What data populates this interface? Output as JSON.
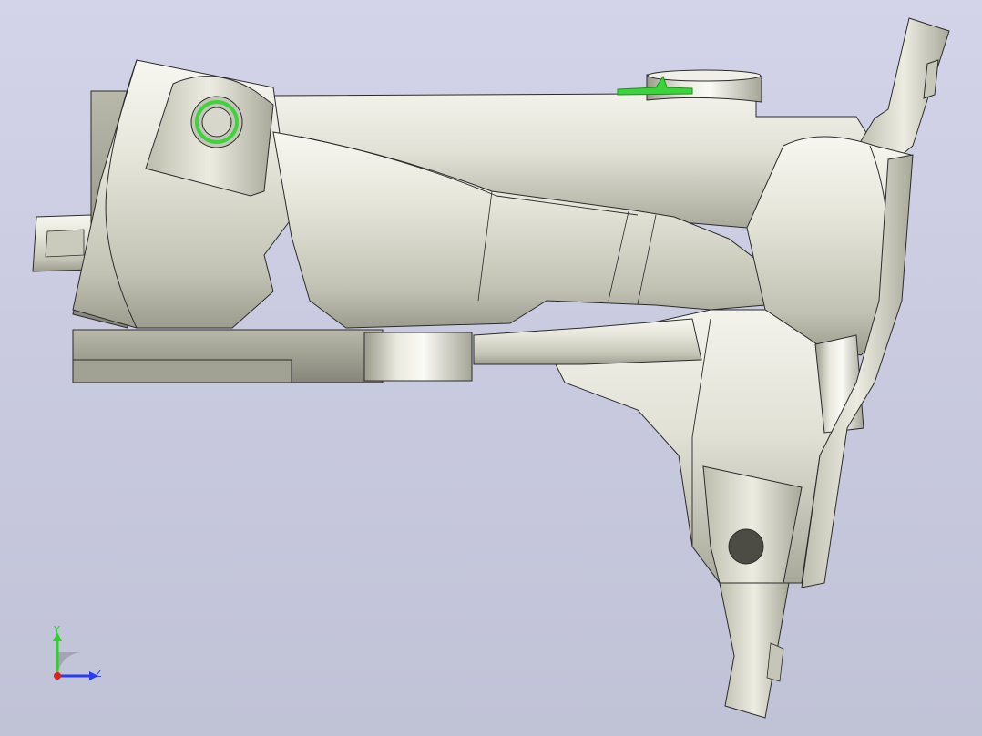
{
  "viewport": {
    "background_top": "#d3d3e9",
    "background_bottom": "#c0c2d6"
  },
  "model": {
    "body_color": "#d8d8cc",
    "highlight_color": "#f4f4ee",
    "shadow_color": "#8e8e80",
    "edge_color": "#2b2b2b",
    "selected_color": "#3cd43c"
  },
  "triad": {
    "y_label": "Y",
    "z_label": "Z",
    "y_color": "#2fcf2f",
    "z_color": "#2a3cf0",
    "x_color": "#e02020",
    "icon": "orientation-triad-icon"
  }
}
